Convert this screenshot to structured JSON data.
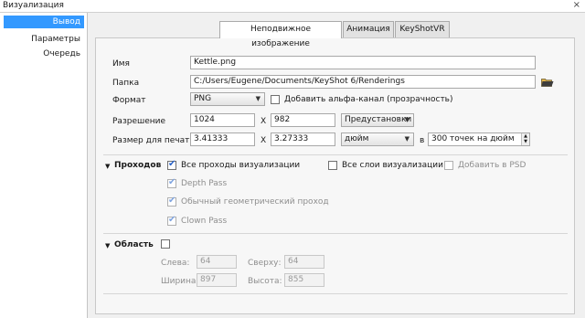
{
  "window": {
    "title": "Визуализация",
    "close": "×"
  },
  "sidebar": {
    "items": [
      {
        "label": "Вывод",
        "active": true
      },
      {
        "label": "Параметры"
      },
      {
        "label": "Очередь"
      }
    ]
  },
  "tabs": [
    {
      "label": "Неподвижное изображение",
      "active": true
    },
    {
      "label": "Анимация"
    },
    {
      "label": "KeyShotVR"
    }
  ],
  "output": {
    "name_label": "Имя",
    "name_value": "Kettle.png",
    "folder_label": "Папка",
    "folder_value": "C:/Users/Eugene/Documents/KeyShot 6/Renderings",
    "folder_icon": "folder-icon",
    "format_label": "Формат",
    "format_value": "PNG",
    "alpha_label": "Добавить альфа-канал (прозрачность)",
    "alpha_checked": false,
    "resolution_label": "Разрешение",
    "res_width": "1024",
    "res_x": "X",
    "res_height": "982",
    "presets_label": "Предустановки",
    "print_label": "Размер для печати",
    "print_width": "3.41333",
    "print_x": "X",
    "print_height": "3.27333",
    "unit_value": "дюйм",
    "at_label": "в",
    "dpi_value": "300 точек на дюйм"
  },
  "passes": {
    "header": "Проходов",
    "all_passes_label": "Все проходы визуализации",
    "all_passes_checked": true,
    "all_layers_label": "Все слои визуализации",
    "all_layers_checked": false,
    "add_psd_label": "Добавить в PSD",
    "add_psd_checked": false,
    "items": [
      {
        "label": "Depth Pass",
        "checked": true
      },
      {
        "label": "Обычный геометрический проход",
        "checked": true
      },
      {
        "label": "Clown Pass",
        "checked": true
      }
    ]
  },
  "region": {
    "header": "Область",
    "enabled": false,
    "left_label": "Слева:",
    "left_value": "64",
    "top_label": "Сверху:",
    "top_value": "64",
    "width_label": "Ширина:",
    "width_value": "897",
    "height_label": "Высота:",
    "height_value": "855"
  },
  "colors": {
    "selection": "#3399ff",
    "check": "#2a63c9"
  }
}
